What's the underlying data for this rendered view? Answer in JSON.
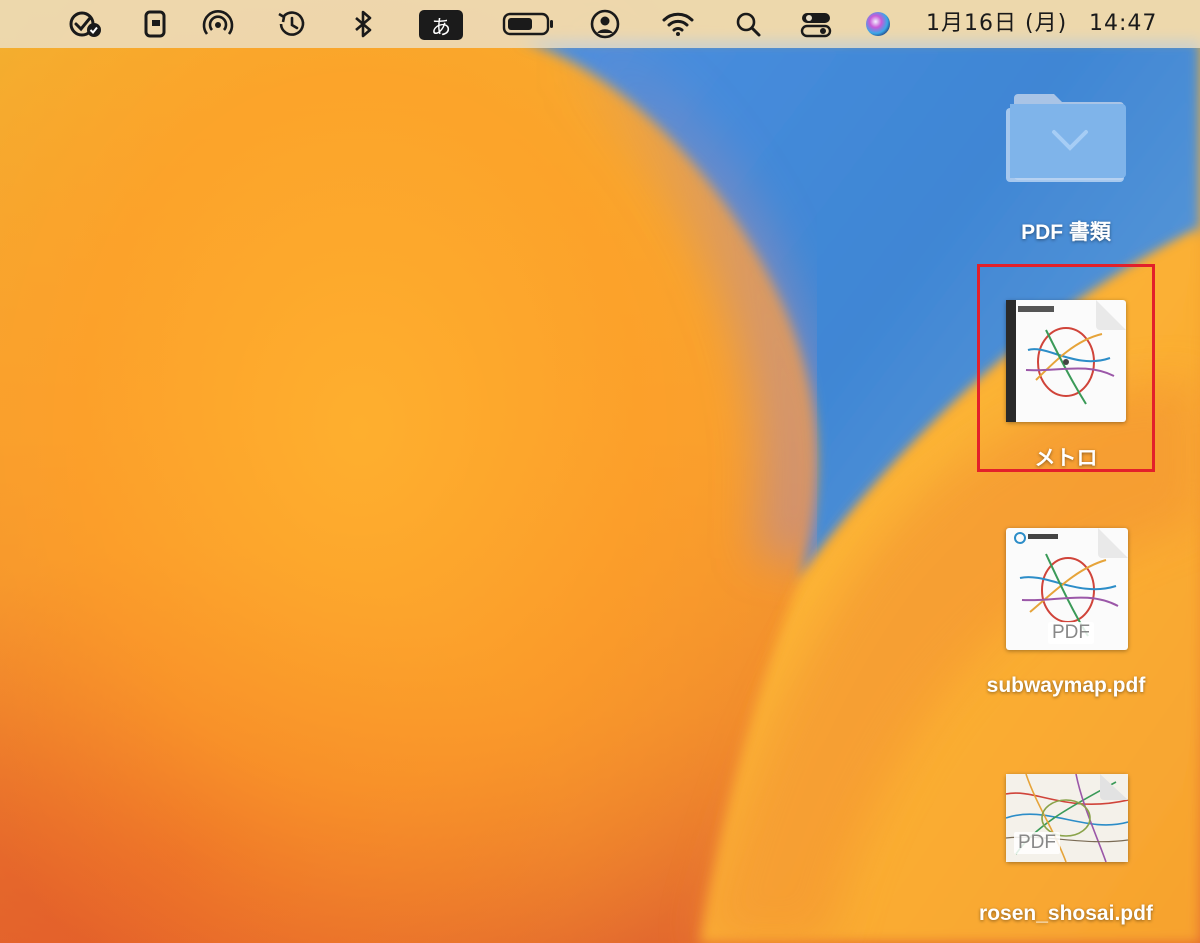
{
  "menubar": {
    "input_method_label": "あ",
    "date": "1月16日 (月)",
    "time": "14:47",
    "icons": [
      "checkmark-badge-icon",
      "phone-icon",
      "airdrop-icon",
      "time-machine-icon",
      "bluetooth-icon",
      "input-method-icon",
      "battery-icon",
      "user-icon",
      "wifi-icon",
      "search-icon",
      "control-center-icon",
      "siri-icon"
    ]
  },
  "desktop": {
    "items": [
      {
        "label": "PDF 書類",
        "kind": "folder",
        "selected": false
      },
      {
        "label": "メトロ",
        "kind": "document",
        "selected": true
      },
      {
        "label": "subwaymap.pdf",
        "kind": "pdf",
        "badge": "PDF",
        "selected": false
      },
      {
        "label": "rosen_shosai.pdf",
        "kind": "pdf",
        "badge": "PDF",
        "selected": false
      }
    ]
  },
  "colors": {
    "highlight_box": "#e3202a",
    "wallpaper_orange": "#f6a030",
    "wallpaper_blue": "#3f88d6"
  }
}
